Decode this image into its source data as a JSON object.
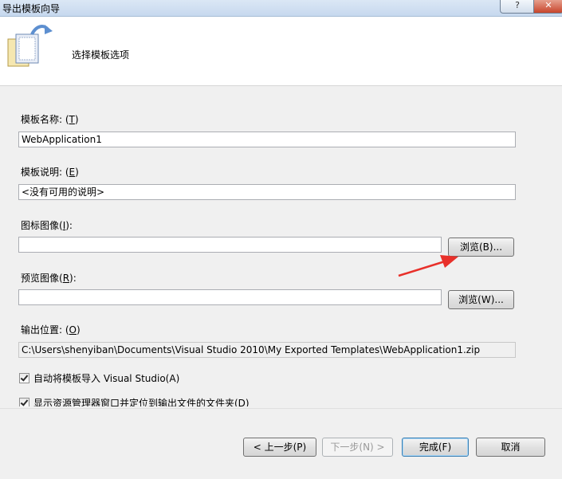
{
  "window": {
    "title": "导出模板向导",
    "help_label": "?",
    "close_label": "✕"
  },
  "header": {
    "title": "选择模板选项"
  },
  "fields": {
    "template_name": {
      "label_pre": "模板名称: (",
      "accel": "T",
      "label_post": ")",
      "value": "WebApplication1"
    },
    "template_desc": {
      "label_pre": "模板说明: (",
      "accel": "E",
      "label_post": ")",
      "value": "<没有可用的说明>"
    },
    "icon_image": {
      "label_pre": "图标图像(",
      "accel": "I",
      "label_post": "):",
      "value": "",
      "browse_label": "浏览(B)..."
    },
    "preview_image": {
      "label_pre": "预览图像(",
      "accel": "R",
      "label_post": "):",
      "value": "",
      "browse_label": "浏览(W)..."
    },
    "output_location": {
      "label_pre": "输出位置: (",
      "accel": "O",
      "label_post": ")",
      "value": "C:\\Users\\shenyiban\\Documents\\Visual Studio 2010\\My Exported Templates\\WebApplication1.zip"
    }
  },
  "options": {
    "auto_import": {
      "label": "自动将模板导入 Visual Studio(A)",
      "checked": true
    },
    "show_explorer": {
      "label": "显示资源管理器窗口并定位到输出文件的文件夹(D)",
      "checked": true
    }
  },
  "footer": {
    "back_label": "< 上一步(P)",
    "next_label": "下一步(N) >",
    "finish_label": "完成(F)",
    "cancel_label": "取消"
  },
  "annotation": {
    "arrow_color": "#e8302a"
  }
}
